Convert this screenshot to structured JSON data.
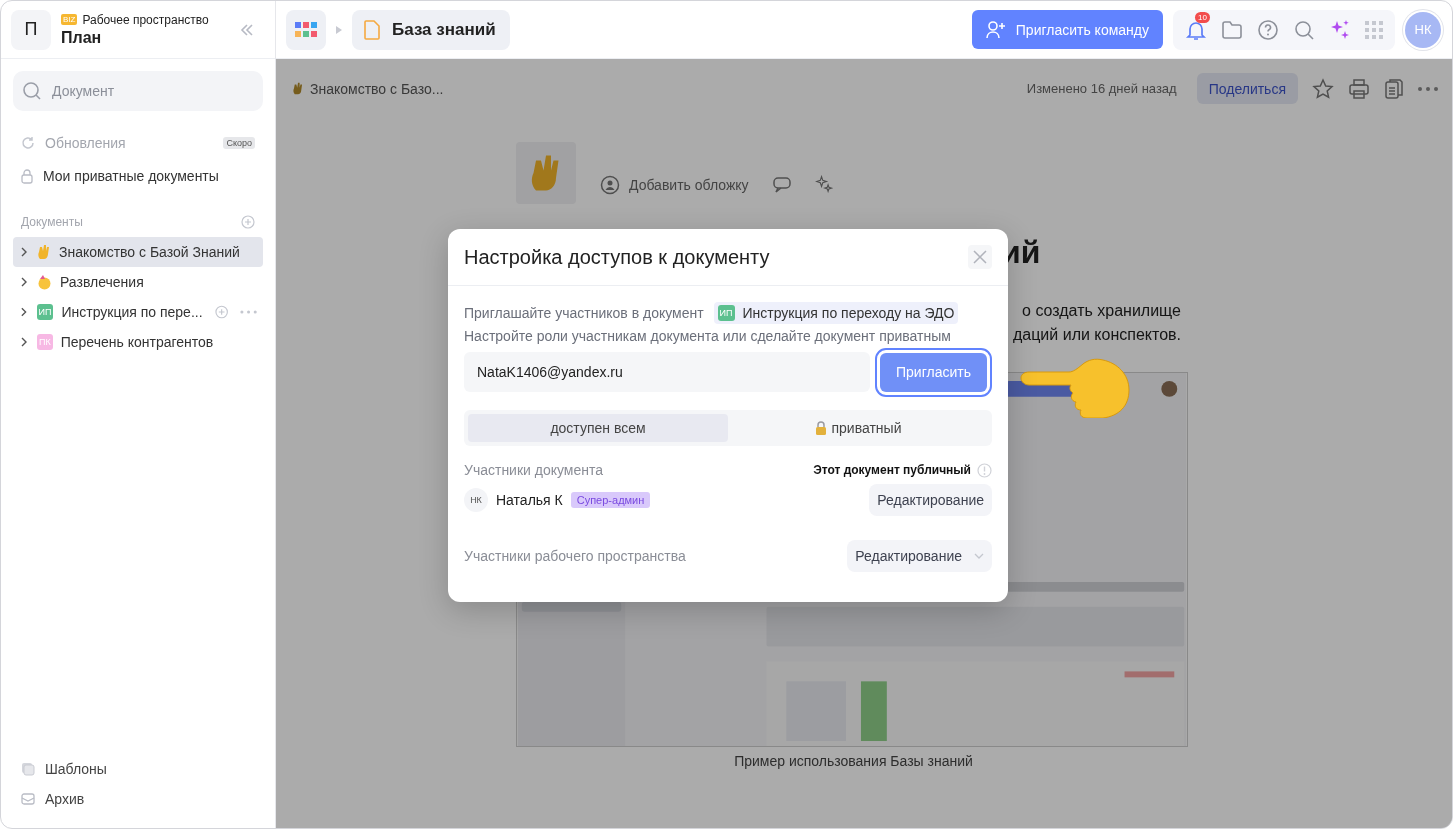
{
  "workspace": {
    "avatar_letter": "П",
    "badge": "BIZ",
    "label": "Рабочее пространство",
    "name": "План"
  },
  "topbar": {
    "breadcrumb_title": "База знаний",
    "invite_button": "Пригласить команду",
    "notifications_count": "10",
    "user_initials": "НК"
  },
  "sidebar": {
    "search_placeholder": "Документ",
    "updates": {
      "label": "Обновления",
      "badge": "Скоро",
      "disabled": true
    },
    "private_docs": "Мои приватные документы",
    "section_title": "Документы",
    "documents": [
      {
        "label": "Знакомство с Базой Знаний",
        "kind": "hand",
        "selected": true,
        "hovered": false
      },
      {
        "label": "Развлечения",
        "kind": "party",
        "selected": false,
        "hovered": false
      },
      {
        "label": "Инструкция по пере...",
        "kind": "initials",
        "initials": "ИП",
        "color": "#5cc08f",
        "selected": false,
        "hovered": true
      },
      {
        "label": "Перечень контрагентов",
        "kind": "initials",
        "initials": "ПК",
        "color": "#f7b8e4",
        "selected": false,
        "hovered": false
      }
    ],
    "bottom_items": [
      {
        "label": "Шаблоны",
        "kind": "templates"
      },
      {
        "label": "Архив",
        "kind": "archive"
      }
    ]
  },
  "document": {
    "breadcrumb": "Знакомство с Базо...",
    "modified": "Изменено 16 дней назад",
    "share_button": "Поделиться",
    "add_cover": "Добавить обложку",
    "heading_fragment": "ий",
    "body_fragments": [
      "о создать хранилище",
      "даций или конспектов."
    ],
    "caption": "Пример использования Базы знаний"
  },
  "modal": {
    "title": "Настройка доступов к документу",
    "invite_text": "Приглашайте участников в документ",
    "doc_chip": {
      "initials": "ИП",
      "color": "#5cc08f",
      "label": "Инструкция по переходу на ЭДО"
    },
    "hint": "Настройте роли участникам документа или сделайте документ приватным",
    "email": "NataK1406@yandex.ru",
    "invite_button": {
      "label": "Пригласить",
      "focused": true
    },
    "access_tabs": [
      {
        "label": "доступен всем",
        "kind": "public",
        "selected": true
      },
      {
        "label": "приватный",
        "kind": "private",
        "selected": false
      }
    ],
    "members_title": "Участники документа",
    "public_note": "Этот документ публичный",
    "members": [
      {
        "initials": "НК",
        "name": "Наталья К",
        "role": "Супер-админ",
        "permission": "Редактирование"
      }
    ],
    "workspace_members": {
      "label": "Участники рабочего пространства",
      "permission": "Редактирование"
    }
  }
}
